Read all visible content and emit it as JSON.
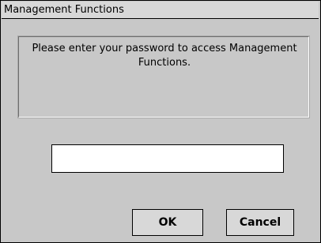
{
  "window": {
    "title": "Management Functions"
  },
  "message": {
    "text": "Please enter your password to access Management Functions."
  },
  "password_field": {
    "value": ""
  },
  "buttons": {
    "ok_label": "OK",
    "cancel_label": "Cancel"
  }
}
